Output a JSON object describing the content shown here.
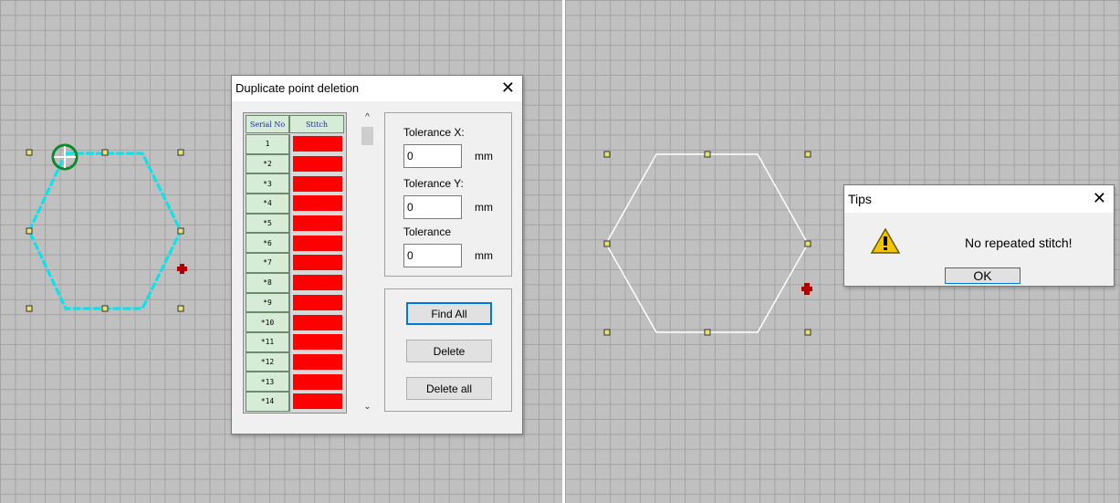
{
  "dialog": {
    "title": "Duplicate point deletion",
    "list": {
      "headers": [
        "Serial No",
        "Stitch"
      ],
      "rows": [
        "1",
        "*2",
        "*3",
        "*4",
        "*5",
        "*6",
        "*7",
        "*8",
        "*9",
        "*10",
        "*11",
        "*12",
        "*13",
        "*14"
      ],
      "stitch_color": "#ff0000"
    },
    "tolerance_x": {
      "label": "Tolerance X:",
      "value": "0",
      "unit": "mm"
    },
    "tolerance_y": {
      "label": "Tolerance Y:",
      "value": "0",
      "unit": "mm"
    },
    "tolerance": {
      "label": "Tolerance",
      "value": "0",
      "unit": "mm"
    },
    "buttons": {
      "find_all": "Find All",
      "delete": "Delete",
      "delete_all": "Delete all"
    }
  },
  "tips": {
    "title": "Tips",
    "message": "No repeated stitch!",
    "ok": "OK"
  },
  "canvas": {
    "grid_color": "#a3a3a3",
    "background": "#c0c0c0",
    "left_shape_color": "#00e5ee",
    "right_shape_color": "#ffffff",
    "handle_color": "#e8e070",
    "marker_color": "#b00000",
    "start_point_color": "#0a8a2a",
    "icons": [
      "close-icon",
      "warning-icon",
      "crosshair-marker-icon",
      "start-point-icon",
      "chevron-up-icon",
      "chevron-down-icon"
    ]
  }
}
